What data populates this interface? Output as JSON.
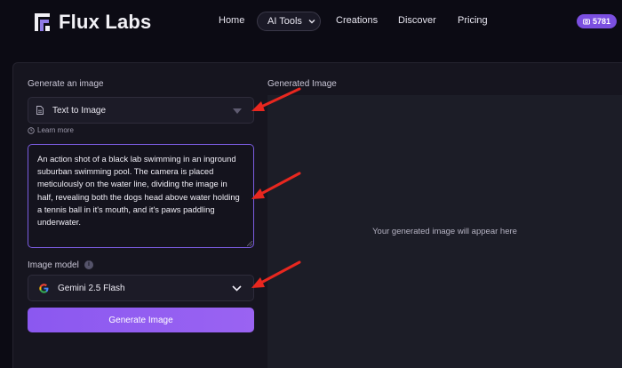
{
  "header": {
    "brand": "Flux Labs",
    "nav": [
      "Home",
      "AI Tools",
      "Creations",
      "Discover",
      "Pricing"
    ],
    "credits": "5781"
  },
  "form": {
    "generate_label": "Generate an image",
    "mode_value": "Text to Image",
    "learn_more": "Learn more",
    "prompt": "An action shot of a black lab swimming in an inground suburban swimming pool. The camera is placed meticulously on the water line, dividing the image in half, revealing both the dogs head above water holding a tennis ball in it's mouth, and it's paws paddling underwater.",
    "model_label": "Image model",
    "model_value": "Gemini 2.5 Flash",
    "generate_button": "Generate Image"
  },
  "output": {
    "label": "Generated Image",
    "placeholder": "Your generated image will appear here"
  },
  "colors": {
    "accent": "#8b58f0",
    "annotation_arrow": "#e8271f"
  }
}
